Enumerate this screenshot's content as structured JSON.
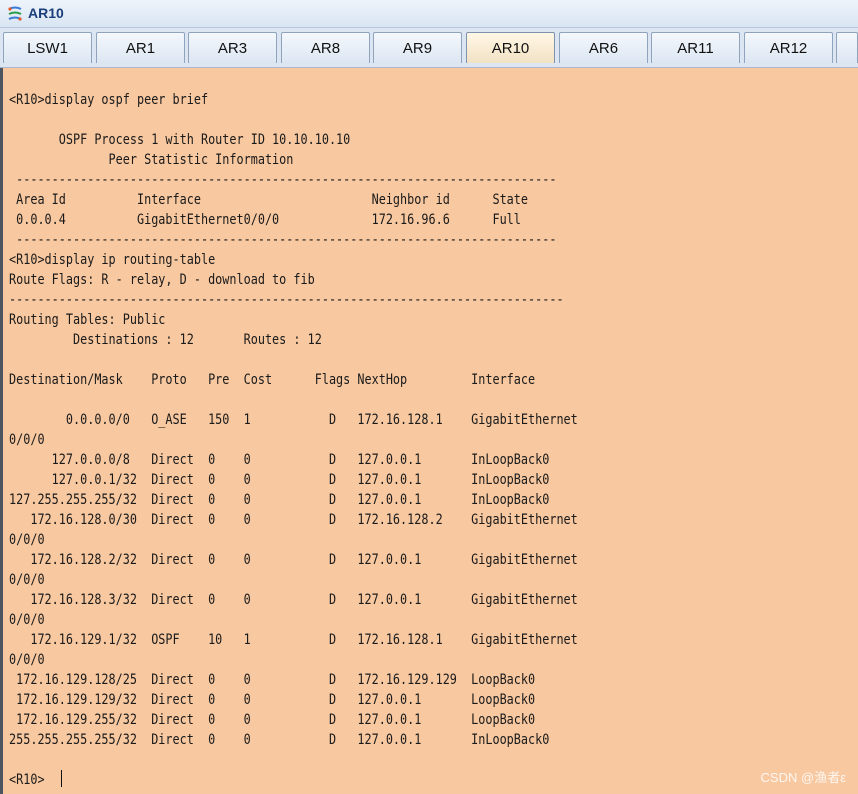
{
  "window": {
    "title": "AR10"
  },
  "tabs": [
    {
      "label": "LSW1"
    },
    {
      "label": "AR1"
    },
    {
      "label": "AR3"
    },
    {
      "label": "AR8"
    },
    {
      "label": "AR9"
    },
    {
      "label": "AR10"
    },
    {
      "label": "AR6"
    },
    {
      "label": "AR11"
    },
    {
      "label": "AR12"
    }
  ],
  "active_tab": "AR10",
  "colors": {
    "console_bg": "#f8c8a0",
    "title_text": "#1a3e7a",
    "tab_active_bg": "#f2e2c4"
  },
  "console": {
    "lines": [
      "<R10>display ospf peer brief",
      "",
      "       OSPF Process 1 with Router ID 10.10.10.10",
      "              Peer Statistic Information",
      " ----------------------------------------------------------------------------",
      " Area Id          Interface                        Neighbor id      State",
      " 0.0.0.4          GigabitEthernet0/0/0             172.16.96.6      Full",
      " ----------------------------------------------------------------------------",
      "<R10>display ip routing-table",
      "Route Flags: R - relay, D - download to fib",
      "------------------------------------------------------------------------------",
      "Routing Tables: Public",
      "         Destinations : 12       Routes : 12",
      "",
      "Destination/Mask    Proto   Pre  Cost      Flags NextHop         Interface",
      "",
      "        0.0.0.0/0   O_ASE   150  1           D   172.16.128.1    GigabitEthernet",
      "0/0/0",
      "      127.0.0.0/8   Direct  0    0           D   127.0.0.1       InLoopBack0",
      "      127.0.0.1/32  Direct  0    0           D   127.0.0.1       InLoopBack0",
      "127.255.255.255/32  Direct  0    0           D   127.0.0.1       InLoopBack0",
      "   172.16.128.0/30  Direct  0    0           D   172.16.128.2    GigabitEthernet",
      "0/0/0",
      "   172.16.128.2/32  Direct  0    0           D   127.0.0.1       GigabitEthernet",
      "0/0/0",
      "   172.16.128.3/32  Direct  0    0           D   127.0.0.1       GigabitEthernet",
      "0/0/0",
      "   172.16.129.1/32  OSPF    10   1           D   172.16.128.1    GigabitEthernet",
      "0/0/0",
      " 172.16.129.128/25  Direct  0    0           D   172.16.129.129  LoopBack0",
      " 172.16.129.129/32  Direct  0    0           D   127.0.0.1       LoopBack0",
      " 172.16.129.255/32  Direct  0    0           D   127.0.0.1       LoopBack0",
      "255.255.255.255/32  Direct  0    0           D   127.0.0.1       InLoopBack0",
      "",
      "<R10>"
    ]
  },
  "watermark": "CSDN @渔者ε"
}
